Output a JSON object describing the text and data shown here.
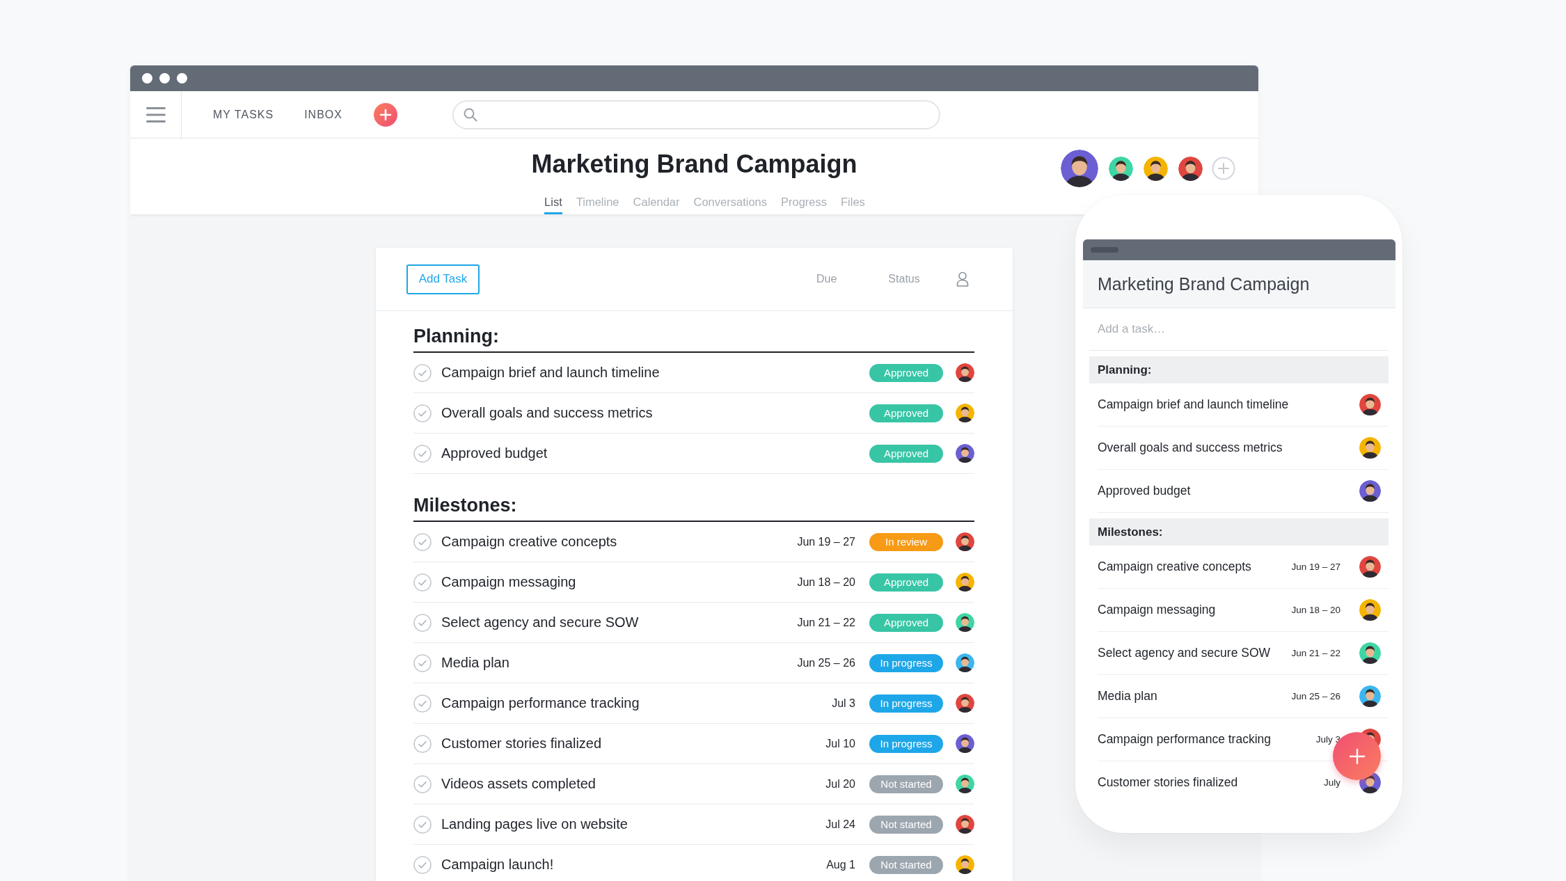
{
  "browser": {
    "nav": {
      "links": [
        {
          "label": "MY TASKS"
        },
        {
          "label": "INBOX"
        }
      ]
    },
    "project": {
      "title": "Marketing Brand Campaign",
      "members": [
        {
          "color": "#6b5fd3"
        },
        {
          "color": "#3ed6a4"
        },
        {
          "color": "#f5b400"
        },
        {
          "color": "#e0463f"
        }
      ],
      "tabs": [
        {
          "label": "List",
          "selected": true
        },
        {
          "label": "Timeline",
          "selected": false
        },
        {
          "label": "Calendar",
          "selected": false
        },
        {
          "label": "Conversations",
          "selected": false
        },
        {
          "label": "Progress",
          "selected": false
        },
        {
          "label": "Files",
          "selected": false
        }
      ]
    },
    "list": {
      "add_button": "Add Task",
      "columns": [
        "Due",
        "Status"
      ],
      "sections": [
        {
          "title": "Planning:",
          "tasks": [
            {
              "name": "Campaign brief and launch timeline",
              "status": {
                "label": "Approved",
                "color": "#37c5a6"
              },
              "color": "#e0463f"
            },
            {
              "name": "Overall goals and success metrics",
              "status": {
                "label": "Approved",
                "color": "#37c5a6"
              },
              "color": "#f5b400"
            },
            {
              "name": "Approved budget",
              "status": {
                "label": "Approved",
                "color": "#37c5a6"
              },
              "color": "#6b5fd3"
            }
          ]
        },
        {
          "title": "Milestones:",
          "tasks": [
            {
              "name": "Campaign creative concepts",
              "due": "Jun 19 – 27",
              "status": {
                "label": "In review",
                "color": "#f79a16"
              },
              "color": "#e0463f"
            },
            {
              "name": "Campaign messaging",
              "due": "Jun 18 – 20",
              "status": {
                "label": "Approved",
                "color": "#37c5a6"
              },
              "color": "#f5b400"
            },
            {
              "name": "Select agency and secure SOW",
              "due": "Jun 21 – 22",
              "status": {
                "label": "Approved",
                "color": "#37c5a6"
              },
              "color": "#3ed6a4"
            },
            {
              "name": "Media plan",
              "due": "Jun 25 – 26",
              "status": {
                "label": "In progress",
                "color": "#1ea7e8"
              },
              "color": "#3bb7f0"
            },
            {
              "name": "Campaign performance tracking",
              "due": "Jul 3",
              "status": {
                "label": "In progress",
                "color": "#1ea7e8"
              },
              "color": "#e0463f"
            },
            {
              "name": "Customer stories finalized",
              "due": "Jul 10",
              "status": {
                "label": "In progress",
                "color": "#1ea7e8"
              },
              "color": "#6b5fd3"
            },
            {
              "name": "Videos assets completed",
              "due": "Jul 20",
              "status": {
                "label": "Not started",
                "color": "#9ca6af"
              },
              "color": "#3ed6a4"
            },
            {
              "name": "Landing pages live on website",
              "due": "Jul 24",
              "status": {
                "label": "Not started",
                "color": "#9ca6af"
              },
              "color": "#e0463f"
            },
            {
              "name": "Campaign launch!",
              "due": "Aug 1",
              "status": {
                "label": "Not started",
                "color": "#9ca6af"
              },
              "color": "#f5b400"
            }
          ]
        }
      ]
    }
  },
  "mobile": {
    "title": "Marketing Brand Campaign",
    "add_task": {
      "placeholder": "Add a task…"
    },
    "sections": [
      {
        "title": "Planning:",
        "tasks": [
          {
            "name": "Campaign brief and launch timeline",
            "color": "#e0463f"
          },
          {
            "name": "Overall goals and success metrics",
            "color": "#f5b400"
          },
          {
            "name": "Approved budget",
            "color": "#6b5fd3"
          }
        ]
      },
      {
        "title": "Milestones:",
        "tasks": [
          {
            "name": "Campaign creative concepts",
            "due": "Jun 19 – 27",
            "color": "#e0463f"
          },
          {
            "name": "Campaign messaging",
            "due": "Jun 18 – 20",
            "color": "#f5b400"
          },
          {
            "name": "Select agency and secure SOW",
            "due": "Jun 21 – 22",
            "color": "#3ed6a4"
          },
          {
            "name": "Media plan",
            "due": "Jun 25 – 26",
            "color": "#3bb7f0"
          },
          {
            "name": "Campaign performance tracking",
            "due": "July 3",
            "color": "#e0463f"
          },
          {
            "name": "Customer stories finalized",
            "due": "July",
            "color": "#6b5fd3"
          }
        ]
      }
    ]
  }
}
